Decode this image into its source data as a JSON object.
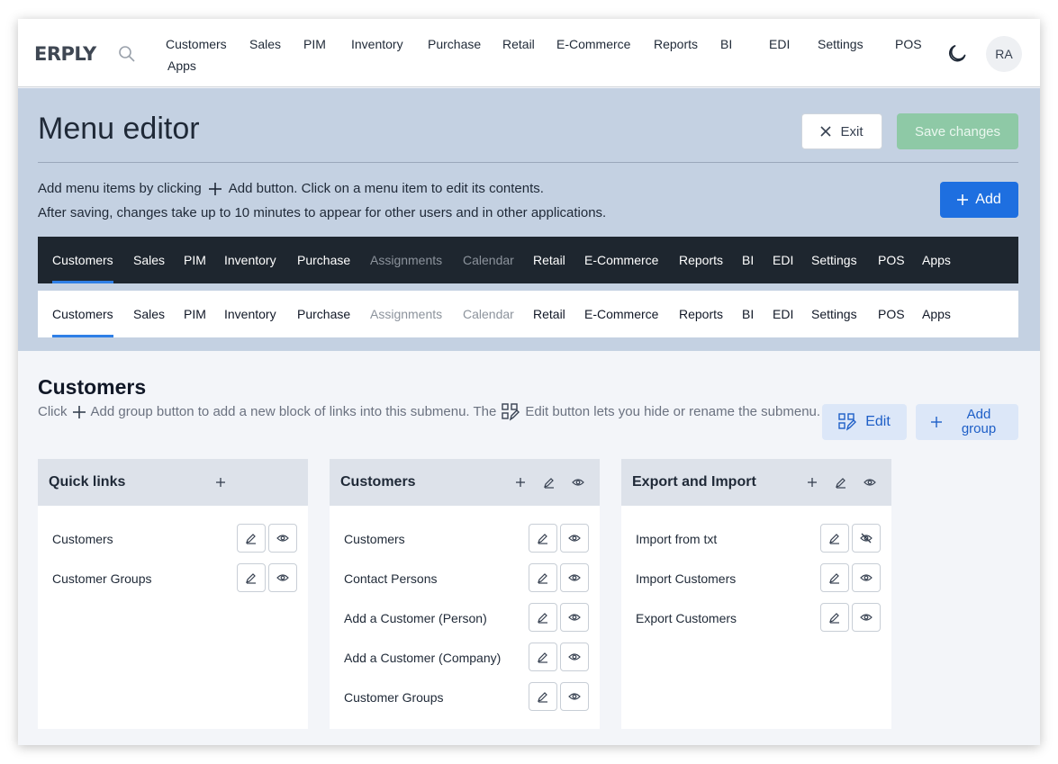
{
  "app": {
    "logo": "ERPLY"
  },
  "topnav": {
    "items": [
      "Customers",
      "Sales",
      "PIM",
      "Inventory",
      "Purchase",
      "Retail",
      "E-Commerce",
      "Reports",
      "BI",
      "EDI",
      "Settings",
      "POS",
      "Apps"
    ],
    "avatar": "RA"
  },
  "header": {
    "title": "Menu editor",
    "exit_label": "Exit",
    "save_label": "Save changes",
    "help_line1_a": "Add menu items by clicking",
    "help_line1_b": "Add button. Click on a menu item to edit its contents.",
    "help_line2": "After saving, changes take up to 10 minutes to appear for other users and in other applications.",
    "add_label": "Add"
  },
  "preview": {
    "items": [
      "Customers",
      "Sales",
      "PIM",
      "Inventory",
      "Purchase",
      "Assignments",
      "Calendar",
      "Retail",
      "E-Commerce",
      "Reports",
      "BI",
      "EDI",
      "Settings",
      "POS",
      "Apps"
    ],
    "disabled": [
      "Assignments",
      "Calendar"
    ],
    "active": "Customers"
  },
  "submenu": {
    "title": "Customers",
    "help_a": "Click",
    "help_b": "Add group button to add a new block of links into this submenu. The",
    "help_c": "Edit button lets you hide or rename the submenu.",
    "edit_label": "Edit",
    "add_group_label": "Add group"
  },
  "groups": [
    {
      "title": "Quick links",
      "links": [
        {
          "label": "Customers",
          "hidden": false
        },
        {
          "label": "Customer Groups",
          "hidden": false
        }
      ]
    },
    {
      "title": "Customers",
      "links": [
        {
          "label": "Customers",
          "hidden": false
        },
        {
          "label": "Contact Persons",
          "hidden": false
        },
        {
          "label": "Add a Customer (Person)",
          "hidden": false
        },
        {
          "label": "Add a Customer (Company)",
          "hidden": false
        },
        {
          "label": "Customer Groups",
          "hidden": false
        }
      ]
    },
    {
      "title": "Export and Import",
      "links": [
        {
          "label": "Import from txt",
          "hidden": true
        },
        {
          "label": "Import Customers",
          "hidden": false
        },
        {
          "label": "Export Customers",
          "hidden": false
        }
      ]
    }
  ],
  "colors": {
    "primary": "#1e6fe0",
    "save_disabled": "#8ec9a6",
    "header_bg": "#c4d1e2",
    "dark_preview": "#1e262f",
    "active_underline": "#2f7fe6"
  }
}
